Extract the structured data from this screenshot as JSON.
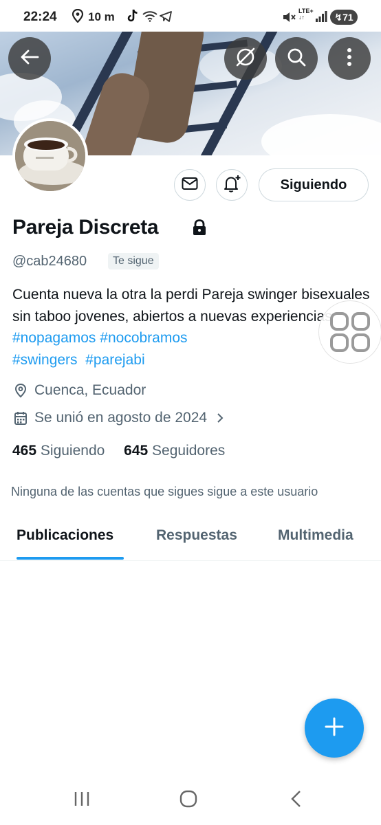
{
  "status_bar": {
    "time": "22:24",
    "distance": "10 m",
    "network": "LTE+",
    "battery": "71"
  },
  "banner": {
    "back_icon": "arrow-left-icon",
    "grok_icon": "slash-circle-icon",
    "search_icon": "search-icon",
    "more_icon": "more-vertical-icon"
  },
  "profile": {
    "name": "Pareja Discreta",
    "handle": "@cab24680",
    "follows_you": "Te sigue",
    "follow_button": "Siguiendo",
    "bio_text": "Cuenta nueva la otra la perdi  Pareja swinger bisexuales sin taboo jovenes, abiertos a nuevas experiencias ",
    "hashtags": [
      "#nopagamos",
      "#nocobramos",
      "#swingers",
      "#parejabi"
    ],
    "location": "Cuenca, Ecuador",
    "joined": "Se unió en agosto de 2024",
    "following_count": "465",
    "following_label": "Siguiendo",
    "followers_count": "645",
    "followers_label": "Seguidores",
    "mutual_note": "Ninguna de las cuentas que sigues sigue a este usuario"
  },
  "tabs": [
    {
      "label": "Publicaciones",
      "active": true
    },
    {
      "label": "Respuestas",
      "active": false
    },
    {
      "label": "Multimedia",
      "active": false
    }
  ],
  "colors": {
    "accent": "#1d9bf0",
    "text": "#0f1419",
    "secondary": "#536471"
  }
}
